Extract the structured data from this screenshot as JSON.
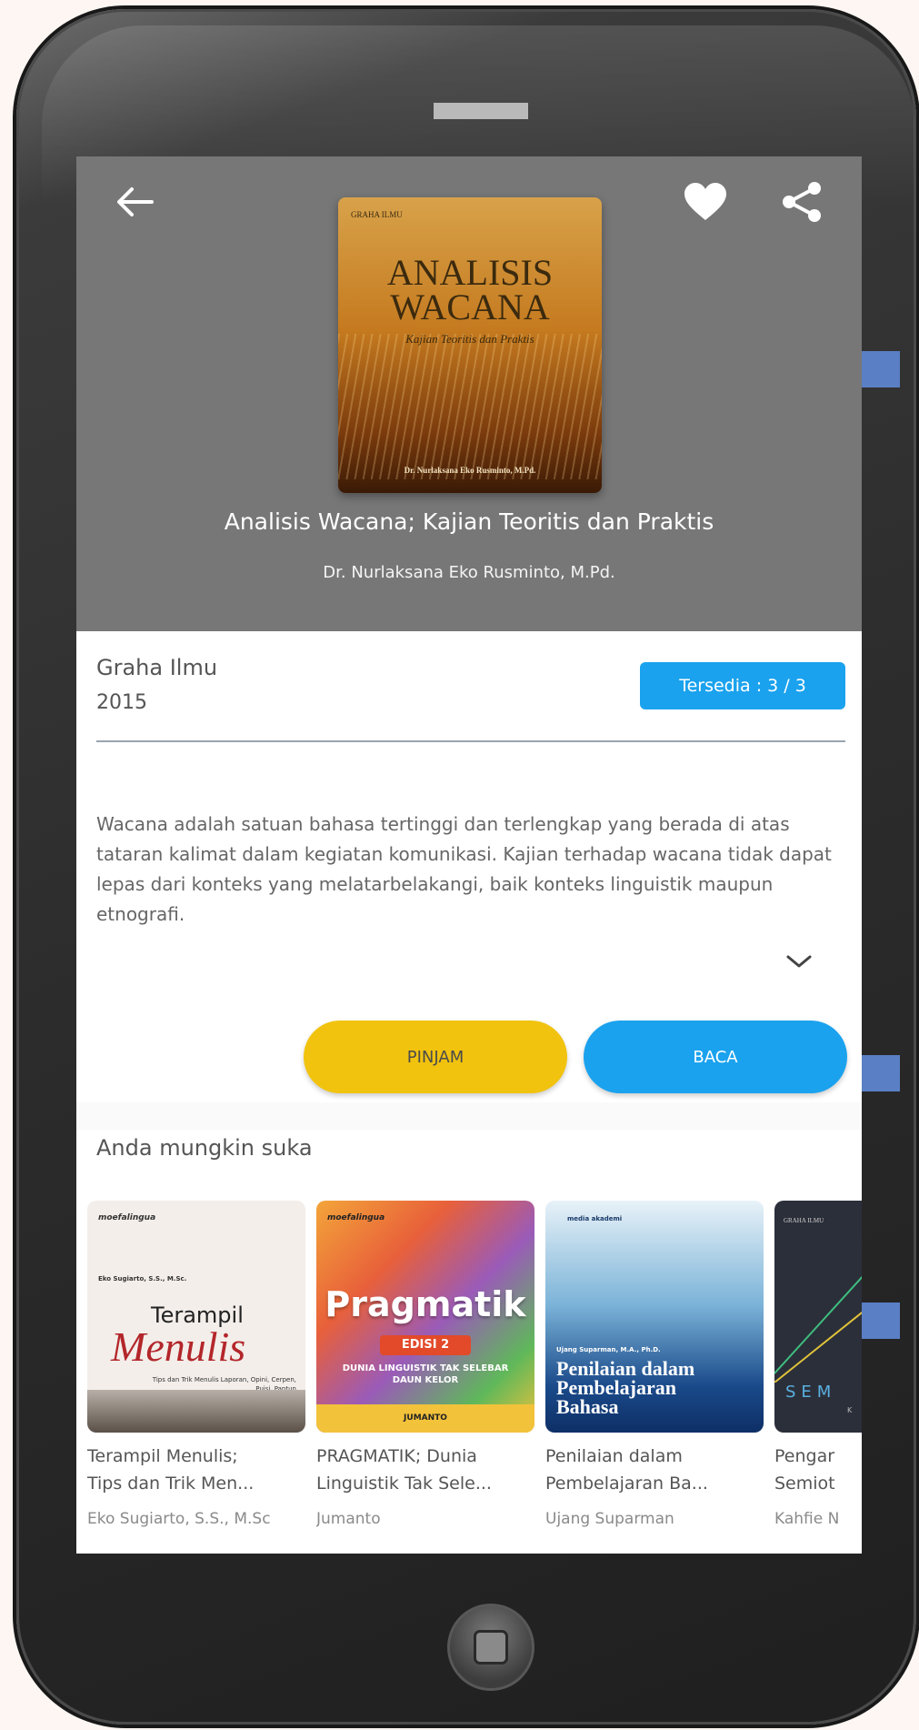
{
  "colors": {
    "header_bg": "#777777",
    "accent_blue": "#1aa2ee",
    "accent_yellow": "#f1c30f"
  },
  "header": {
    "back_icon": "arrow-left-icon",
    "favorite_icon": "heart-icon",
    "share_icon": "share-icon"
  },
  "cover": {
    "publisher": "GRAHA ILMU",
    "title_line1": "ANALISIS",
    "title_line2": "WACANA",
    "subtitle": "Kajian Teoritis dan Praktis",
    "author": "Dr. Nurlaksana Eko Rusminto, M.Pd."
  },
  "book": {
    "title": "Analisis Wacana; Kajian Teoritis dan Praktis",
    "author": "Dr. Nurlaksana Eko Rusminto, M.Pd.",
    "publisher": "Graha Ilmu",
    "year": "2015",
    "availability": "Tersedia : 3 / 3",
    "description": "Wacana adalah satuan bahasa tertinggi dan terlengkap yang berada di atas tataran kalimat dalam kegiatan komunikasi. Kajian terhadap wacana tidak dapat lepas dari konteks yang melatarbelakangi, baik konteks linguistik maupun etnografi."
  },
  "actions": {
    "borrow_label": "PINJAM",
    "read_label": "BACA"
  },
  "recommendations": {
    "heading": "Anda mungkin suka",
    "items": [
      {
        "title_line1": "Terampil Menulis;",
        "title_line2": "Tips dan Trik Men...",
        "author": "Eko Sugiarto, S.S., M.Sc",
        "cover_publisher": "moefalingua",
        "cover_author": "Eko Sugiarto, S.S., M.Sc.",
        "cover_title_1": "Terampil",
        "cover_title_2": "Menulis",
        "cover_sub": "Tips dan Trik Menulis Laporan, Opini, Cerpen, Puisi, Pantun"
      },
      {
        "title_line1": "PRAGMATIK; Dunia",
        "title_line2": "Linguistik Tak Sele...",
        "author": "Jumanto",
        "cover_publisher": "moefalingua",
        "cover_title": "Pragmatik",
        "cover_edition": "EDISI 2",
        "cover_sub": "DUNIA LINGUISTIK TAK SELEBAR DAUN KELOR",
        "cover_author": "JUMANTO"
      },
      {
        "title_line1": "Penilaian dalam",
        "title_line2": "Pembelajaran Ba...",
        "author": "Ujang Suparman",
        "cover_publisher": "media akademi",
        "cover_author": "Ujang Suparman, M.A., Ph.D.",
        "cover_title": "Penilaian dalam Pembelajaran Bahasa"
      },
      {
        "title_line1": "Pengar",
        "title_line2": "Semiot",
        "author": "Kahfie N",
        "cover_publisher": "GRAHA ILMU",
        "cover_title": "SEM",
        "cover_sub": "K"
      }
    ]
  }
}
